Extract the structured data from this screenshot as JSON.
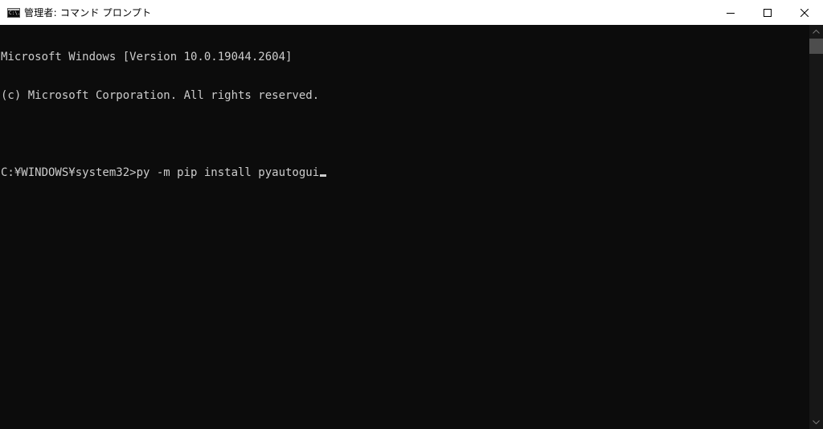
{
  "window": {
    "title": "管理者: コマンド プロンプト",
    "icon_name": "cmd-icon",
    "icon_glyph": "C:\\.",
    "buttons": {
      "minimize_icon": "minimize-icon",
      "maximize_icon": "maximize-icon",
      "close_icon": "close-icon"
    }
  },
  "console": {
    "lines": [
      "Microsoft Windows [Version 10.0.19044.2604]",
      "(c) Microsoft Corporation. All rights reserved.",
      "",
      "C:¥WINDOWS¥system32>py -m pip install pyautogui"
    ],
    "colors": {
      "background": "#0c0c0c",
      "foreground": "#cccccc"
    }
  },
  "scrollbar": {
    "position_fraction": 0
  }
}
